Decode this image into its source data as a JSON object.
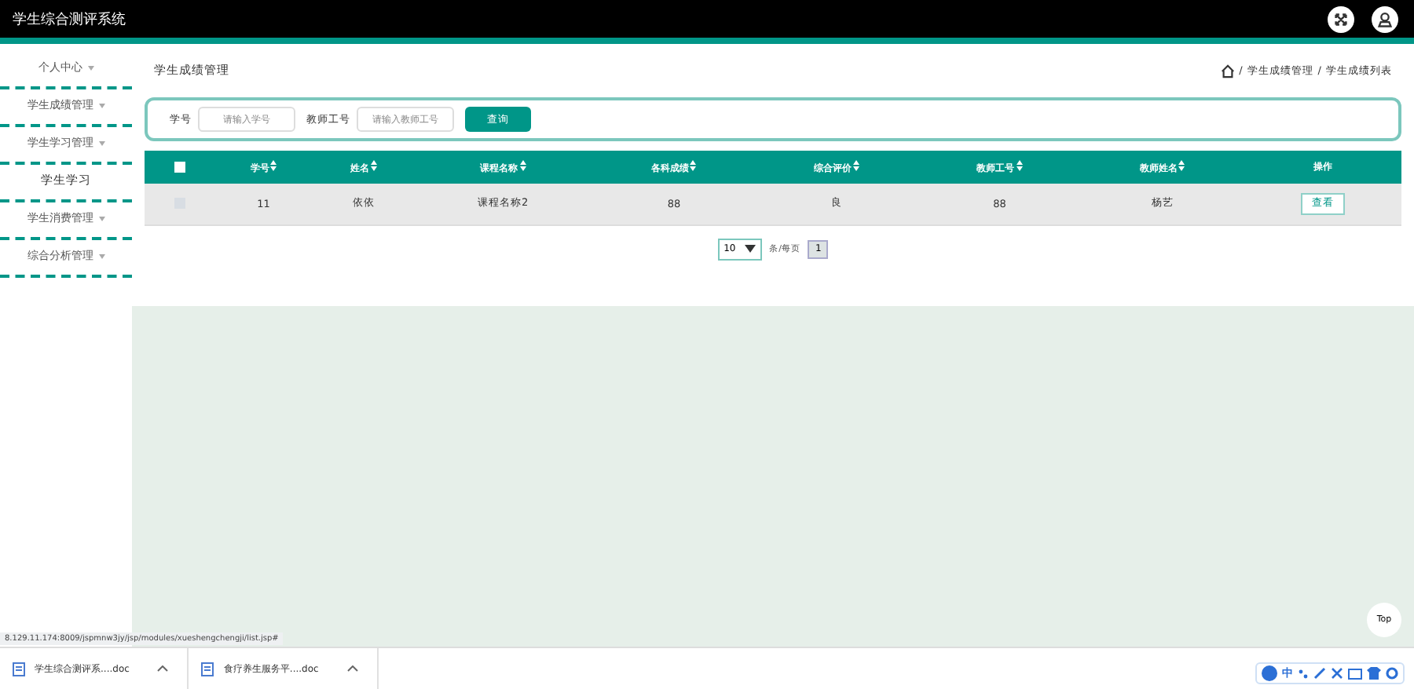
{
  "header": {
    "title": "学生综合测评系统"
  },
  "sidebar": {
    "items": [
      {
        "label": "个人中心"
      },
      {
        "label": "学生成绩管理"
      },
      {
        "label": "学生学习管理",
        "children": [
          {
            "label": "学生学习"
          }
        ]
      },
      {
        "label": "学生消费管理"
      },
      {
        "label": "综合分析管理"
      }
    ]
  },
  "page_title": "学生成绩管理",
  "breadcrumb": {
    "separator": "/",
    "items": [
      "学生成绩管理",
      "学生成绩列表"
    ]
  },
  "search": {
    "fields": [
      {
        "label": "学号",
        "placeholder": "请输入学号"
      },
      {
        "label": "教师工号",
        "placeholder": "请输入教师工号"
      }
    ],
    "button": "查询"
  },
  "table": {
    "all_checked": false,
    "columns": [
      {
        "label": "学号",
        "sortable": true
      },
      {
        "label": "姓名",
        "sortable": true
      },
      {
        "label": "课程名称",
        "sortable": true
      },
      {
        "label": "各科成绩",
        "sortable": true
      },
      {
        "label": "综合评价",
        "sortable": true
      },
      {
        "label": "教师工号",
        "sortable": true
      },
      {
        "label": "教师姓名",
        "sortable": true
      },
      {
        "label": "操作",
        "sortable": false
      }
    ],
    "rows": [
      {
        "checked": false,
        "cells": [
          "11",
          "依依",
          "课程名称2",
          "88",
          "良",
          "88",
          "杨艺"
        ],
        "action": "查看"
      }
    ]
  },
  "pagination": {
    "page_size": "10",
    "page_size_label": "条/每页",
    "pages": [
      {
        "label": "1",
        "selected": true
      }
    ]
  },
  "top_button": "Top",
  "status_url": "8.129.11.174:8009/jspmnw3jy/jsp/modules/xueshengchengji/list.jsp#",
  "downloads": [
    {
      "name": "学生综合测评系....doc"
    },
    {
      "name": "食疗养生服务平....doc"
    }
  ],
  "ime": {
    "mode": "中"
  }
}
